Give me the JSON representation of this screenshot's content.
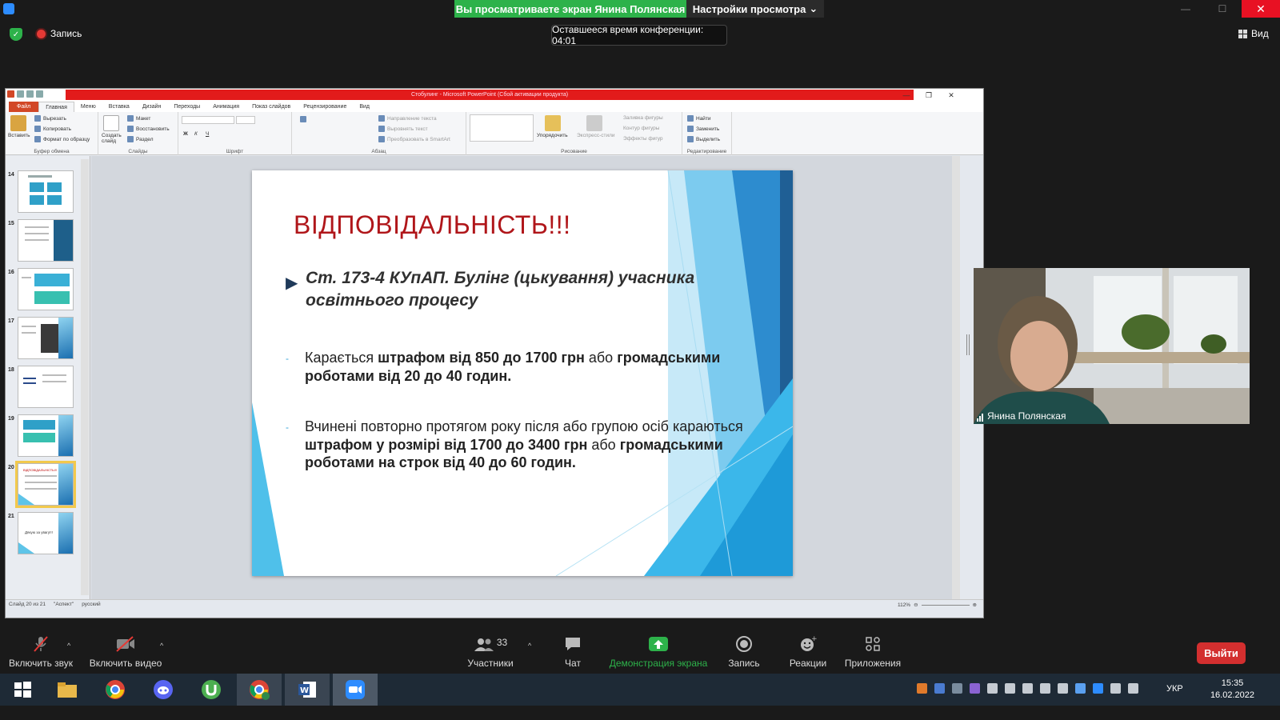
{
  "top_bar": {
    "share_banner": "Вы просматриваете экран Янина Полянская",
    "view_options": "Настройки просмотра",
    "recording_label": "Запись",
    "timer": "Оставшееся время конференции: 04:01",
    "view_label": "Вид"
  },
  "ppt": {
    "title": "Cтобулинг - Microsoft PowerPoint (Сбой активации продукта)",
    "tabs": [
      "Файл",
      "Главная",
      "Меню",
      "Вставка",
      "Дизайн",
      "Переходы",
      "Анимация",
      "Показ слайдов",
      "Рецензирование",
      "Вид"
    ],
    "ribbon": {
      "clipboard": {
        "paste": "Вставить",
        "cut": "Вырезать",
        "copy": "Копировать",
        "format": "Формат по образцу",
        "label": "Буфер обмена"
      },
      "slides": {
        "create": "Создать слайд",
        "layout": "Макет",
        "reset": "Восстановить",
        "section": "Раздел",
        "label": "Слайды"
      },
      "font": {
        "label": "Шрифт"
      },
      "paragraph": {
        "direction": "Направление текста",
        "align": "Выровнять текст",
        "smartart": "Преобразовать в SmartArt",
        "label": "Абзац"
      },
      "drawing": {
        "arrange": "Упорядочить",
        "styles": "Экспресс-стили",
        "fill": "Заливка фигуры",
        "outline": "Контур фигуры",
        "effects": "Эффекты фигур",
        "label": "Рисование"
      },
      "editing": {
        "find": "Найти",
        "replace": "Заменить",
        "select": "Выделить",
        "label": "Редактирование"
      }
    },
    "thumbnails": [
      {
        "num": "14"
      },
      {
        "num": "15"
      },
      {
        "num": "16"
      },
      {
        "num": "17"
      },
      {
        "num": "18"
      },
      {
        "num": "19"
      },
      {
        "num": "20",
        "text": "ВІДПОВІДАЛЬНІСТЬ!!!"
      },
      {
        "num": "21",
        "text": "Дякую за увагу!!!"
      }
    ],
    "status": {
      "slide": "Слайд 20 из 21",
      "theme": "\"Аспект\"",
      "lang": "русский",
      "zoom": "112%"
    }
  },
  "slide": {
    "title": "ВІДПОВІДАЛЬНІСТЬ!!!",
    "bullet": "Ст. 173-4 КУпАП. Булінг (цькування) учасника освітнього процесу",
    "p1": {
      "a": "Карається ",
      "b": "штрафом від 850 до 1700 грн",
      "c": " або ",
      "d": "громадськими роботами від 20 до 40 годин."
    },
    "p2": {
      "a": "Вчинені повторно протягом року після або групою осіб караються ",
      "b": "штрафом у розмірі від 1700 до 3400 грн",
      "c": " або ",
      "d": "громадськими роботами на строк від 40 до 60 годин."
    }
  },
  "video": {
    "name": "Янина Полянская"
  },
  "toolbar": {
    "mic": "Включить звук",
    "video": "Включить видео",
    "participants": "Участники",
    "participants_count": "33",
    "chat": "Чат",
    "share": "Демонстрация экрана",
    "record": "Запись",
    "reactions": "Реакции",
    "apps": "Приложения",
    "exit": "Выйти"
  },
  "taskbar": {
    "lang": "УКР",
    "time": "15:35",
    "date": "16.02.2022"
  },
  "colors": {
    "share_green": "#2db24a",
    "exit_red": "#d32f2f",
    "title_red": "#b0161a",
    "ppt_orange": "#d24726"
  }
}
